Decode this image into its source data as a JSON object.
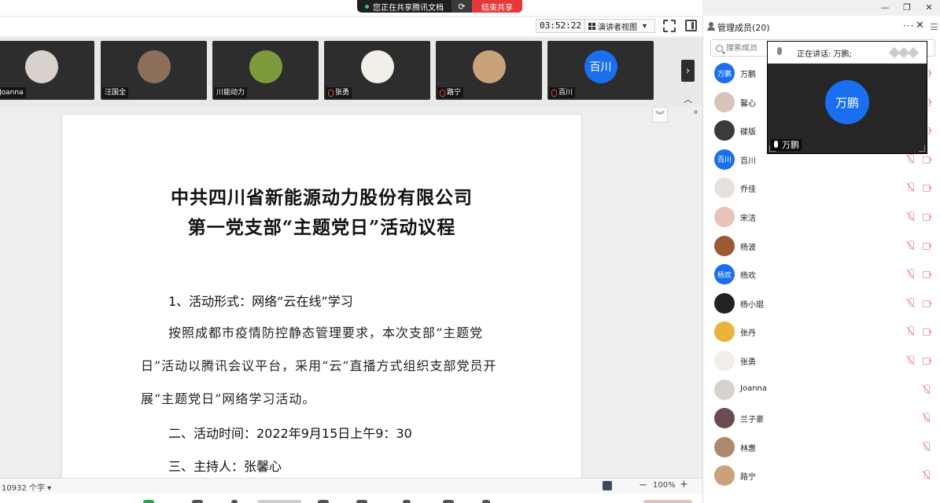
{
  "share_bar": {
    "status_text": "您正在共享腾讯文档",
    "end_label": "结束共享"
  },
  "window_controls": {
    "minimize": "—",
    "restore": "❐",
    "close": "✕"
  },
  "toolbar": {
    "timer": "03:52:22",
    "view_label": "演讲者视图",
    "view_arrow": "▾"
  },
  "video_strip": {
    "tiles": [
      {
        "name": "Joanna",
        "color": "#d9d2cc",
        "muted": true
      },
      {
        "name": "汪国全",
        "color": "#8c6f5a",
        "muted": false
      },
      {
        "name": "川能动力",
        "color": "#7e9b3b",
        "muted": false
      },
      {
        "name": "张勇",
        "color": "#f2efe9",
        "muted": true
      },
      {
        "name": "路宁",
        "color": "#c9a27a",
        "muted": true
      },
      {
        "name": "百川",
        "color": "#1a6ff0",
        "muted": true,
        "initials": "百川"
      }
    ],
    "next_arrow": "›",
    "collapse_arrow": "︿"
  },
  "document": {
    "title_line1": "中共四川省新能源动力股份有限公司",
    "title_line2": "第一党支部“主题党日”活动议程",
    "section1_heading": "1、活动形式：网络“云在线”学习",
    "section1_body": "按照成都市疫情防控静态管理要求，本次支部“主题党日”活动以腾讯会议平台，采用“云”直播方式组织支部党员开展“主题党日”网络学习活动。",
    "section2": "二、活动时间：2022年9月15日上午9：30",
    "section3": "三、主持人：张馨心",
    "collapse_icon": "︾"
  },
  "statusbar": {
    "word_count": "10932 个字 ▾",
    "zoom_minus": "−",
    "zoom_level": "100%",
    "zoom_plus": "+"
  },
  "members_panel": {
    "title": "管理成员(20)",
    "more": "···",
    "close": "✕",
    "search_placeholder": "搜索成员",
    "members": [
      {
        "name": "万鹏",
        "color": "#1a6ff0",
        "initials": "万鹏",
        "mic": true,
        "cam": true
      },
      {
        "name": "馨心",
        "color": "#d8c4b8",
        "initials": "",
        "mic": true,
        "cam": true
      },
      {
        "name": "碟版",
        "color": "#3b3b3b",
        "initials": "",
        "mic": true,
        "cam": true
      },
      {
        "name": "百川",
        "color": "#1a6ff0",
        "initials": "百川",
        "mic": true,
        "cam": true
      },
      {
        "name": "乔佳",
        "color": "#e6e1dc",
        "initials": "",
        "mic": true,
        "cam": true
      },
      {
        "name": "宋洁",
        "color": "#e9c3b8",
        "initials": "",
        "mic": true,
        "cam": true
      },
      {
        "name": "杨波",
        "color": "#9a5a36",
        "initials": "",
        "mic": true,
        "cam": true
      },
      {
        "name": "杨欢",
        "color": "#1a6ff0",
        "initials": "杨欢",
        "mic": true,
        "cam": true
      },
      {
        "name": "杨小琨",
        "color": "#222222",
        "initials": "",
        "mic": true,
        "cam": true
      },
      {
        "name": "张丹",
        "color": "#e8b53a",
        "initials": "",
        "mic": true,
        "cam": true
      },
      {
        "name": "张勇",
        "color": "#f2efe9",
        "initials": "",
        "mic": true,
        "cam": true
      },
      {
        "name": "Joanna",
        "color": "#d9d2cc",
        "initials": "",
        "mic": true,
        "cam": false
      },
      {
        "name": "兰子豪",
        "color": "#6c4a52",
        "initials": "",
        "mic": true,
        "cam": false
      },
      {
        "name": "林惠",
        "color": "#b08a6e",
        "initials": "",
        "mic": true,
        "cam": false
      },
      {
        "name": "路宁",
        "color": "#c9a27a",
        "initials": "",
        "mic": true,
        "cam": false
      }
    ]
  },
  "speaker_window": {
    "speaking_label": "正在讲话: 万鹏;",
    "avatar_text": "万鹏",
    "name": "万鹏"
  }
}
